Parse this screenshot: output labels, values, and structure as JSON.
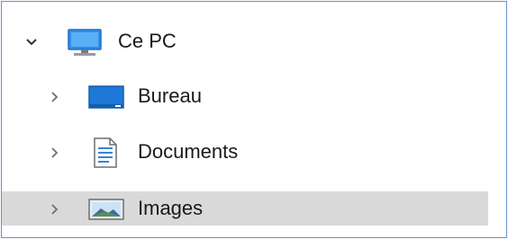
{
  "tree": {
    "items": [
      {
        "label": "Ce PC",
        "icon": "computer-icon",
        "expanded": true
      },
      {
        "label": "Bureau",
        "icon": "desktop-icon",
        "expanded": false
      },
      {
        "label": "Documents",
        "icon": "documents-icon",
        "expanded": false
      },
      {
        "label": "Images",
        "icon": "images-icon",
        "expanded": false,
        "selected": true
      }
    ]
  },
  "colors": {
    "frame_border": "#6b8fcf",
    "selected_row": "#d9d9d9",
    "chevron": "#6e6e6e",
    "chevron_expanded": "#333333",
    "icon_blue": "#1e78d8"
  }
}
